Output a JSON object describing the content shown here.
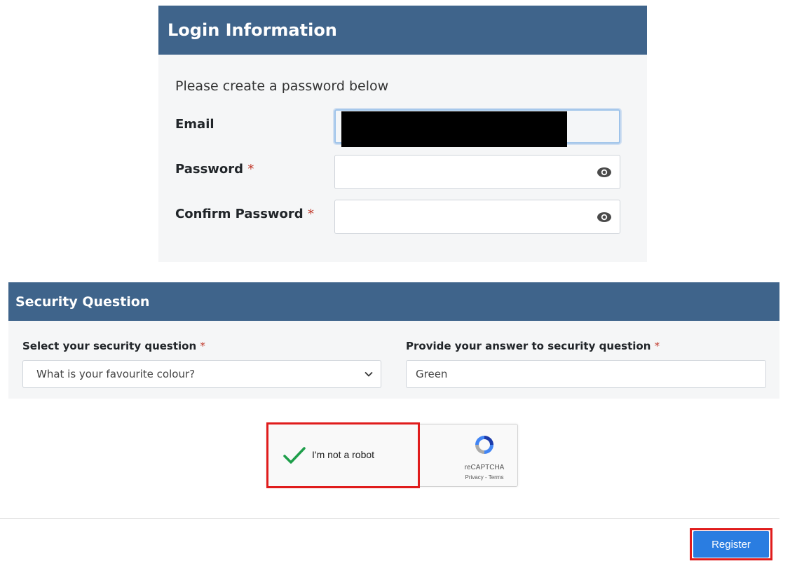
{
  "login": {
    "title": "Login Information",
    "intro": "Please create a password below",
    "email_label": "Email",
    "password_label": "Password",
    "confirm_label": "Confirm Password",
    "required_mark": "*",
    "email_value": "",
    "password_value": "",
    "confirm_value": "",
    "eye_icon": "eye-icon"
  },
  "security": {
    "title": "Security Question",
    "question_label": "Select your security question",
    "answer_label": "Provide your answer to security question",
    "required_mark": "*",
    "selected_question": "What is your favourite colour?",
    "answer_value": "Green"
  },
  "captcha": {
    "checkbox_label": "I'm not a robot",
    "checked": true,
    "brand": "reCAPTCHA",
    "links": "Privacy - Terms"
  },
  "actions": {
    "register_label": "Register"
  },
  "colors": {
    "header_bg": "#3f648b",
    "card_bg": "#f5f6f7",
    "primary_button": "#2a7de1",
    "highlight": "#e01c1c",
    "check_green": "#1e9e4a"
  }
}
